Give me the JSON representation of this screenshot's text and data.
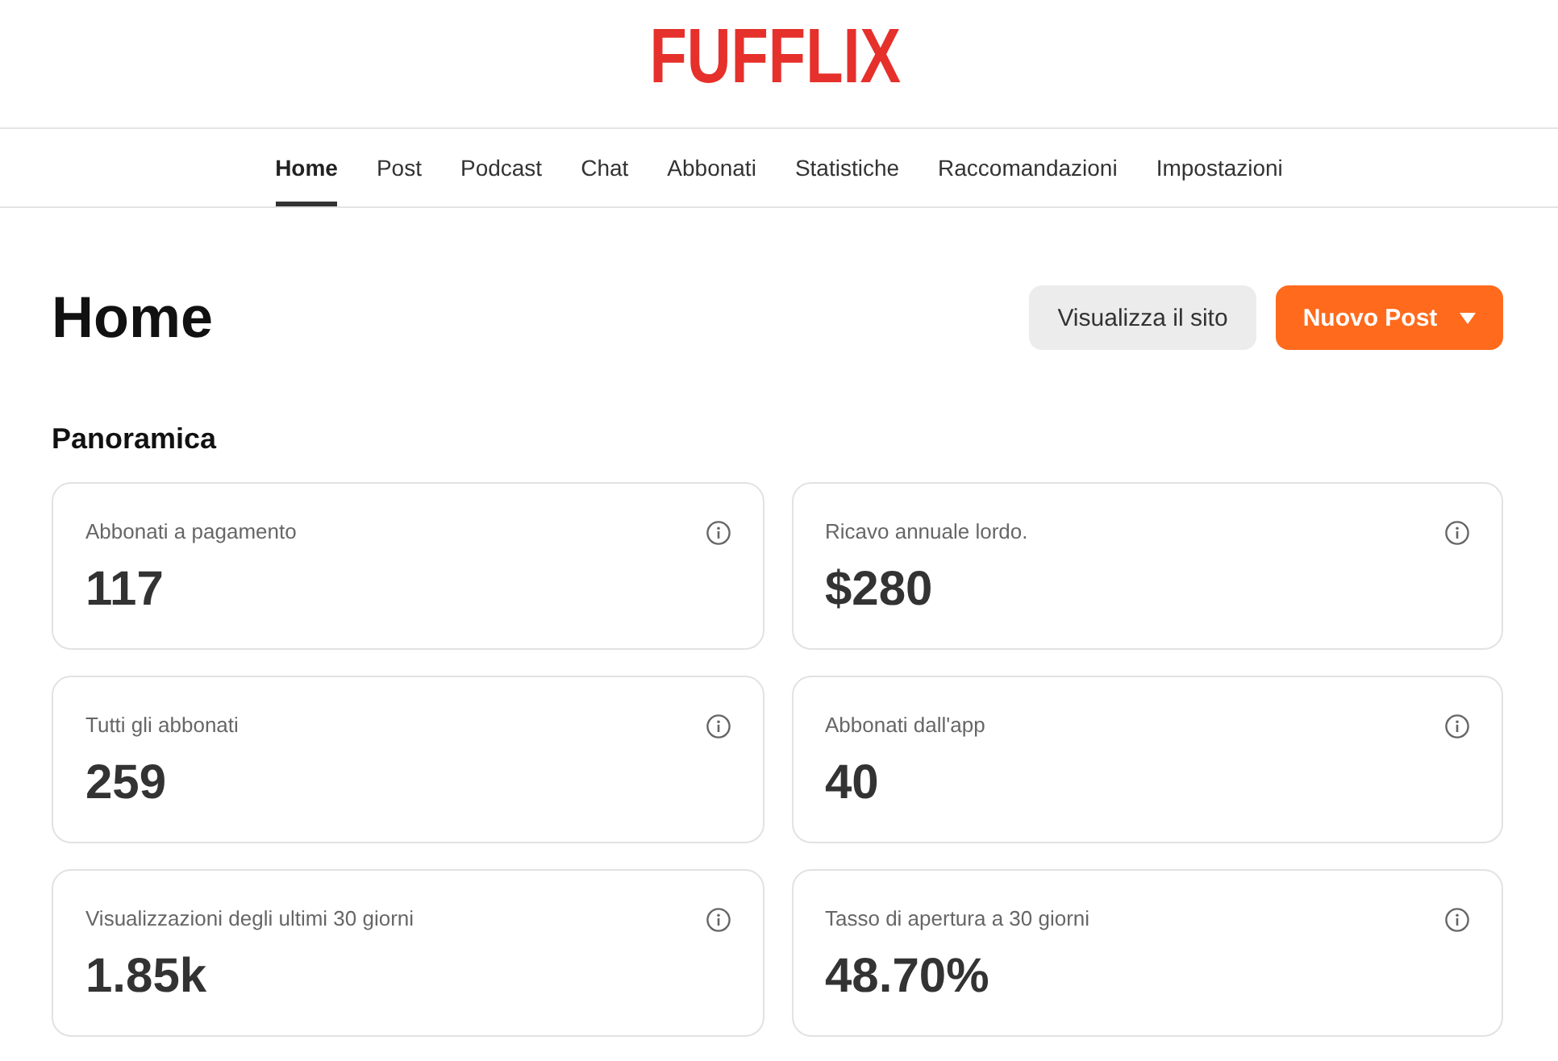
{
  "logo": {
    "text": "FUFFLIX"
  },
  "nav": {
    "tabs": [
      {
        "label": "Home",
        "selected": true
      },
      {
        "label": "Post",
        "selected": false
      },
      {
        "label": "Podcast",
        "selected": false
      },
      {
        "label": "Chat",
        "selected": false
      },
      {
        "label": "Abbonati",
        "selected": false
      },
      {
        "label": "Statistiche",
        "selected": false
      },
      {
        "label": "Raccomandazioni",
        "selected": false
      },
      {
        "label": "Impostazioni",
        "selected": false
      }
    ]
  },
  "page": {
    "title": "Home",
    "buttons": [
      {
        "label": "Visualizza il sito",
        "kind": "secondary"
      },
      {
        "label": "Nuovo Post",
        "kind": "primary",
        "dropdown": true
      }
    ]
  },
  "overview": {
    "title": "Panoramica",
    "cards": [
      {
        "label": "Abbonati a pagamento",
        "value": "117"
      },
      {
        "label": "Ricavo annuale lordo.",
        "value": "$280"
      },
      {
        "label": "Tutti gli abbonati",
        "value": "259"
      },
      {
        "label": "Abbonati dall'app",
        "value": "40"
      },
      {
        "label": "Visualizzazioni degli ultimi 30 giorni",
        "value": "1.85k"
      },
      {
        "label": "Tasso di apertura a 30 giorni",
        "value": "48.70%"
      }
    ]
  }
}
